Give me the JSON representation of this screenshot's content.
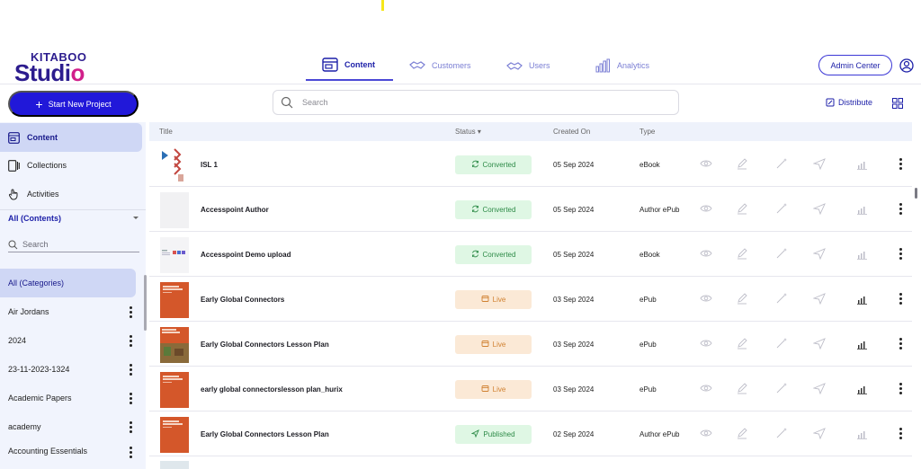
{
  "brand": {
    "top": "KITABOO",
    "main_start": "Studi",
    "main_end": "o"
  },
  "nav": {
    "tabs": [
      {
        "label": "Content"
      },
      {
        "label": "Customers"
      },
      {
        "label": "Users"
      },
      {
        "label": "Analytics"
      }
    ]
  },
  "header": {
    "admin_label": "Admin Center"
  },
  "toolbar": {
    "start_label": "Start New Project",
    "search_placeholder": "Search",
    "distribute_label": "Distribute"
  },
  "sidebar": {
    "items": [
      {
        "label": "Content"
      },
      {
        "label": "Collections"
      },
      {
        "label": "Activities"
      }
    ],
    "filter_label": "All (Contents)",
    "search_placeholder": "Search",
    "categories": [
      {
        "label": "All (Categories)"
      },
      {
        "label": "Air Jordans"
      },
      {
        "label": "2024"
      },
      {
        "label": "23-11-2023-1324"
      },
      {
        "label": "Academic Papers"
      },
      {
        "label": "academy"
      },
      {
        "label": "Accounting Essentials"
      }
    ]
  },
  "table": {
    "headers": {
      "title": "Title",
      "status": "Status",
      "created": "Created On",
      "type": "Type"
    },
    "rows": [
      {
        "title": "ISL 1",
        "status": "Converted",
        "created": "05 Sep 2024",
        "type": "eBook"
      },
      {
        "title": "Accesspoint Author",
        "status": "Converted",
        "created": "05 Sep 2024",
        "type": "Author ePub"
      },
      {
        "title": "Accesspoint Demo upload",
        "status": "Converted",
        "created": "05 Sep 2024",
        "type": "eBook"
      },
      {
        "title": "Early Global Connectors",
        "status": "Live",
        "created": "03 Sep 2024",
        "type": "ePub"
      },
      {
        "title": "Early Global Connectors Lesson Plan",
        "status": "Live",
        "created": "03 Sep 2024",
        "type": "ePub"
      },
      {
        "title": "early global connectorslesson plan_hurix",
        "status": "Live",
        "created": "03 Sep 2024",
        "type": "ePub"
      },
      {
        "title": "Early Global Connectors Lesson Plan",
        "status": "Published",
        "created": "02 Sep 2024",
        "type": "Author ePub"
      }
    ]
  },
  "colors": {
    "primary": "#2118d9",
    "accent": "#d11f8a",
    "converted": "#2e8b48",
    "live": "#d08131"
  }
}
